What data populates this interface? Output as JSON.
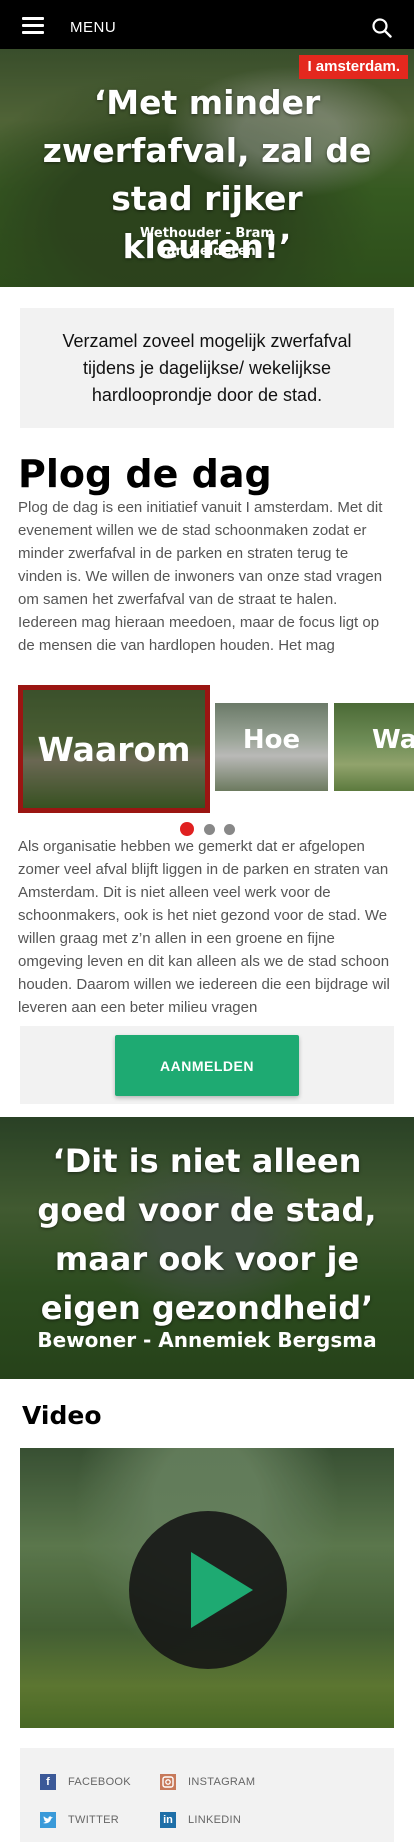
{
  "header": {
    "menu_label": "MENU",
    "menu_icon": "hamburger-icon",
    "search_icon": "search-icon"
  },
  "hero1": {
    "logo": "I amsterdam.",
    "quote": "‘Met minder zwerfafval, zal de stad rijker kleuren!’",
    "attribution": "Wethouder - Bram van Gelderen"
  },
  "intro": {
    "text": "Verzamel zoveel mogelijk zwerfafval tijdens je dagelijkse/ wekelijkse hardlooprondje door de stad."
  },
  "plog": {
    "title": "Plog de dag",
    "body": "Plog de dag is een initiatief vanuit I amsterdam. Met dit evenement willen we de stad schoonmaken zodat er minder zwerfafval in de parken en straten terug te vinden is. We willen de inwoners van onze stad vragen om samen het zwerfafval van de straat te halen. Iedereen mag hieraan meedoen, maar de focus ligt op de mensen die van hardlopen houden. Het mag"
  },
  "carousel": {
    "slides": [
      {
        "label": "Waarom"
      },
      {
        "label": "Hoe"
      },
      {
        "label": "Wa"
      }
    ],
    "active_index": 0,
    "dot_count": 3,
    "active_color": "#9b1512"
  },
  "waarom": {
    "body": "Als organisatie hebben we gemerkt dat er afgelopen zomer veel afval blijft liggen in de parken en straten van Amsterdam. Dit is niet alleen veel werk voor de schoonmakers, ook is het niet gezond voor de stad. We willen graag met z’n allen in een groene en fijne omgeving leven en dit kan alleen als we de stad schoon houden. Daarom willen we iedereen die een bijdrage wil leveren aan een beter milieu vragen"
  },
  "cta": {
    "label": "AANMELDEN",
    "color": "#1eaa72"
  },
  "hero2": {
    "quote": "‘Dit is niet alleen goed voor de stad, maar ook voor je eigen gezondheid’",
    "attribution": "Bewoner - Annemiek Bergsma"
  },
  "video": {
    "title": "Video",
    "play_icon": "play-icon"
  },
  "social": {
    "facebook": "FACEBOOK",
    "instagram": "INSTAGRAM",
    "twitter": "TWITTER",
    "linkedin": "LINKEDIN"
  },
  "colors": {
    "brand_red": "#e4281e",
    "accent_green": "#1eaa72",
    "dot_active": "#e02020"
  }
}
